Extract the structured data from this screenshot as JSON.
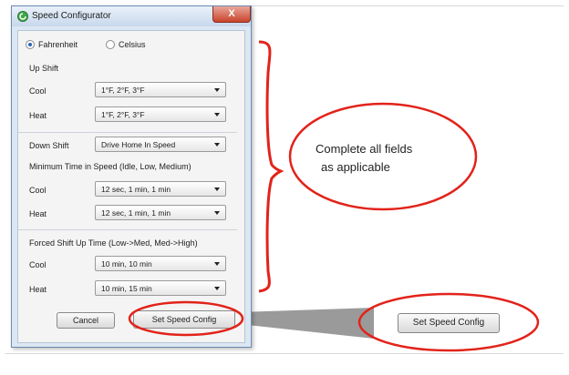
{
  "window": {
    "title": "Speed Configurator",
    "close_label": "X"
  },
  "units": {
    "fahrenheit_label": "Fahrenheit",
    "celsius_label": "Celsius",
    "selected": "Fahrenheit"
  },
  "up_shift": {
    "section_label": "Up Shift",
    "cool_label": "Cool",
    "cool_value": "1°F, 2°F, 3°F",
    "heat_label": "Heat",
    "heat_value": "1°F, 2°F, 3°F"
  },
  "down_shift": {
    "label": "Down Shift",
    "value": "Drive Home In Speed"
  },
  "min_time": {
    "section_label": "Minimum Time in Speed (Idle, Low, Medium)",
    "cool_label": "Cool",
    "cool_value": "12 sec, 1 min, 1 min",
    "heat_label": "Heat",
    "heat_value": "12 sec, 1 min, 1 min"
  },
  "forced_shift": {
    "section_label": "Forced Shift Up Time (Low->Med, Med->High)",
    "cool_label": "Cool",
    "cool_value": "10 min, 10 min",
    "heat_label": "Heat",
    "heat_value": "10 min, 15 min"
  },
  "buttons": {
    "cancel_label": "Cancel",
    "set_label": "Set Speed Config"
  },
  "annotation": {
    "note_line1": "Complete all fields",
    "note_line2": "as applicable",
    "zoom_button_label": "Set Speed Config"
  },
  "colors": {
    "annotation_red": "#e2231a",
    "callout_gray": "#9a9a9a",
    "radio_selected": "#2a62b8"
  }
}
